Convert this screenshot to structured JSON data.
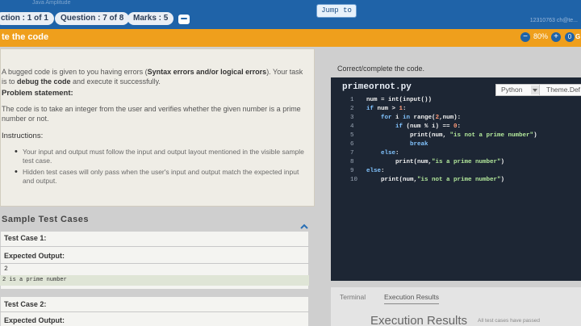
{
  "top": {
    "faint_left": "Java Amplitude",
    "faint_right": "12310763 ch@te...",
    "section": "ction : 1 of 1",
    "question": "Question : 7 of 8",
    "marks": "Marks : 5",
    "jump_to": "Jump to",
    "chat_icon": "chat-bubble-icon"
  },
  "titlebar": {
    "title": "te the code",
    "zoom_minus": "−",
    "zoom_value": "80%",
    "zoom_plus": "+",
    "gear_text": "0",
    "gear_label": "G"
  },
  "problem": {
    "intro_1": "A bugged code is given to you having errors (",
    "intro_bold_1": "Syntax errors and/or logical errors",
    "intro_2": "). Your task is to ",
    "intro_bold_2": "debug the code",
    "intro_3": " and execute it successfully.",
    "statement_heading": "Problem statement:",
    "statement": "The code is to take an integer from the user and verifies whether the given number is a prime number or not.",
    "instructions_heading": "Instructions:",
    "instructions": [
      "Your input and output must follow the input and output layout mentioned in the visible sample test case.",
      "Hidden test cases will only pass when the user's input and output match the expected input and output."
    ]
  },
  "samples": {
    "heading": "Sample  Test  Cases",
    "cases": [
      {
        "title": "Test Case 1:",
        "expected_label": "Expected Output:",
        "input": "2",
        "output": "2 is a prime number"
      },
      {
        "title": "Test Case 2:",
        "expected_label": "Expected Output:"
      }
    ]
  },
  "editor": {
    "header": "Correct/complete the code.",
    "filename": "primeornot.py",
    "language": "Python",
    "theme": "Theme.Def",
    "lines": [
      {
        "n": "1",
        "segs": [
          [
            "num = int(input())",
            "tx"
          ]
        ]
      },
      {
        "n": "2",
        "segs": [
          [
            "if ",
            "kw"
          ],
          [
            "num > ",
            "tx"
          ],
          [
            "1",
            "nb"
          ],
          [
            ":",
            "tx"
          ]
        ]
      },
      {
        "n": "3",
        "segs": [
          [
            "    for ",
            "kw"
          ],
          [
            "i ",
            "tx"
          ],
          [
            "in ",
            "kw"
          ],
          [
            "range(",
            "tx"
          ],
          [
            "2",
            "nb"
          ],
          [
            ",num):",
            "tx"
          ]
        ]
      },
      {
        "n": "4",
        "segs": [
          [
            "        if ",
            "kw"
          ],
          [
            "(num % i) == ",
            "tx"
          ],
          [
            "0",
            "nb"
          ],
          [
            ":",
            "tx"
          ]
        ]
      },
      {
        "n": "5",
        "segs": [
          [
            "            print(num, ",
            "tx"
          ],
          [
            "\"is not a prime number\"",
            "st"
          ],
          [
            ")",
            "tx"
          ]
        ]
      },
      {
        "n": "6",
        "segs": [
          [
            "            break",
            "kw"
          ]
        ]
      },
      {
        "n": "7",
        "segs": [
          [
            "    else",
            "kw"
          ],
          [
            ":",
            "tx"
          ]
        ]
      },
      {
        "n": "8",
        "segs": [
          [
            "        print(num,",
            "tx"
          ],
          [
            "\"is a prime number\"",
            "st"
          ],
          [
            ")",
            "tx"
          ]
        ]
      },
      {
        "n": "9",
        "segs": [
          [
            "else",
            "kw"
          ],
          [
            ":",
            "tx"
          ]
        ]
      },
      {
        "n": "10",
        "segs": [
          [
            "    print(num,",
            "tx"
          ],
          [
            "\"is not a prime number\"",
            "st"
          ],
          [
            ")",
            "tx"
          ]
        ]
      }
    ]
  },
  "results": {
    "tab_terminal": "Terminal",
    "tab_results": "Execution Results",
    "title": "Execution Results",
    "note": "All test cases have passed"
  },
  "colors": {
    "topbar": "#1f63a8",
    "titlebar": "#ef9f1c",
    "editor_bg": "#1d2634",
    "keyword": "#82c4ff",
    "string": "#b3e89b"
  }
}
